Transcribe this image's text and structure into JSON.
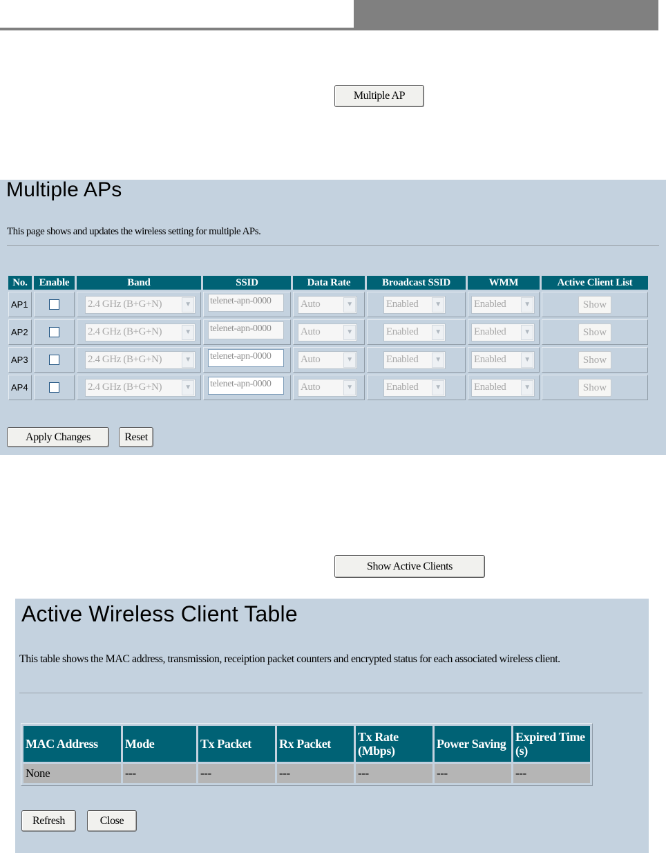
{
  "multiple_ap_button": "Multiple AP",
  "show_active_clients_button": "Show Active Clients",
  "multiple_aps": {
    "title": "Multiple APs",
    "description": "This page shows and updates the wireless setting for multiple APs.",
    "headers": [
      "No.",
      "Enable",
      "Band",
      "SSID",
      "Data Rate",
      "Broadcast SSID",
      "WMM",
      "Active Client List"
    ],
    "rows": [
      {
        "no": "AP1",
        "band": "2.4 GHz (B+G+N)",
        "ssid": "telenet-apn-0000",
        "rate": "Auto",
        "broadcast": "Enabled",
        "wmm": "Enabled",
        "list": "Show"
      },
      {
        "no": "AP2",
        "band": "2.4 GHz (B+G+N)",
        "ssid": "telenet-apn-0000",
        "rate": "Auto",
        "broadcast": "Enabled",
        "wmm": "Enabled",
        "list": "Show"
      },
      {
        "no": "AP3",
        "band": "2.4 GHz (B+G+N)",
        "ssid": "telenet-apn-0000",
        "rate": "Auto",
        "broadcast": "Enabled",
        "wmm": "Enabled",
        "list": "Show"
      },
      {
        "no": "AP4",
        "band": "2.4 GHz (B+G+N)",
        "ssid": "telenet-apn-0000",
        "rate": "Auto",
        "broadcast": "Enabled",
        "wmm": "Enabled",
        "list": "Show"
      }
    ],
    "apply_label": "Apply Changes",
    "reset_label": "Reset"
  },
  "client_table": {
    "title": "Active Wireless Client Table",
    "description": "This table shows the MAC address, transmission, receiption packet counters and encrypted status for each associated wireless client.",
    "headers": [
      "MAC Address",
      "Mode",
      "Tx Packet",
      "Rx Packet",
      "Tx Rate (Mbps)",
      "Power Saving",
      "Expired Time (s)"
    ],
    "row": [
      "None",
      "---",
      "---",
      "---",
      "---",
      "---",
      "---"
    ],
    "refresh_label": "Refresh",
    "close_label": "Close"
  },
  "colors": {
    "panel": "#c4d2df",
    "header_cell": "#006275",
    "header_strip": "#808080"
  }
}
